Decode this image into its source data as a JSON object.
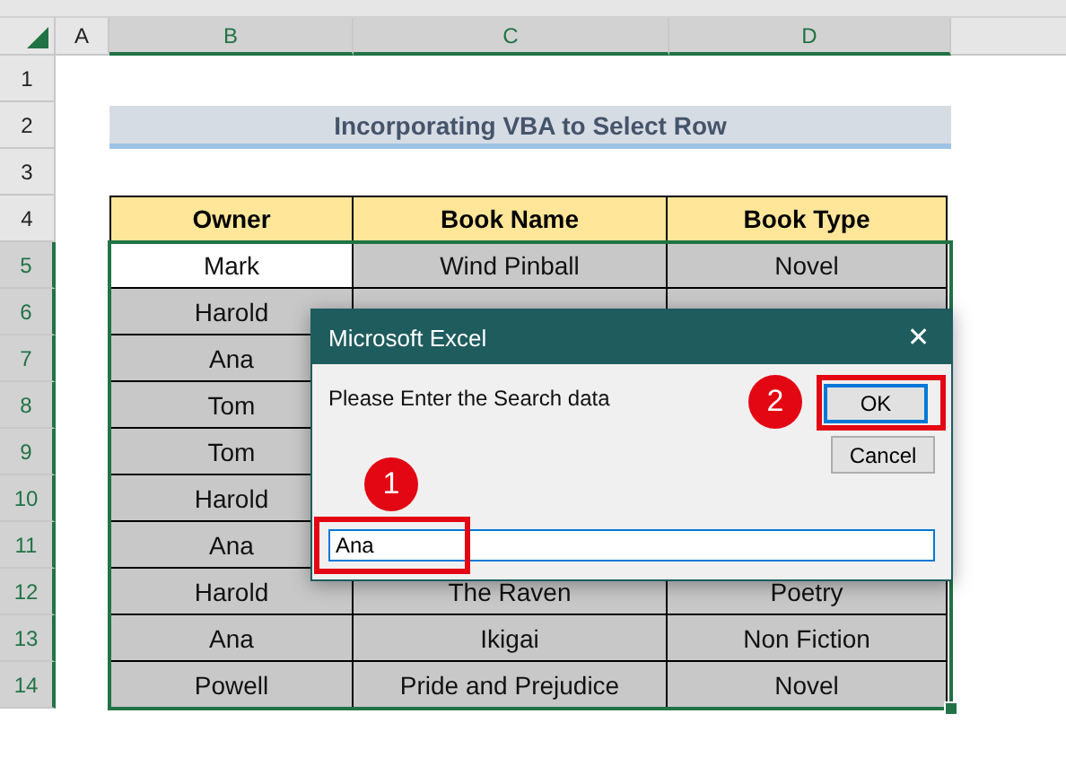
{
  "columns": [
    {
      "label": "A",
      "selected": false
    },
    {
      "label": "B",
      "selected": true
    },
    {
      "label": "C",
      "selected": true
    },
    {
      "label": "D",
      "selected": true
    }
  ],
  "row_numbers": [
    {
      "label": "1",
      "selected": false
    },
    {
      "label": "2",
      "selected": false
    },
    {
      "label": "3",
      "selected": false
    },
    {
      "label": "4",
      "selected": false
    },
    {
      "label": "5",
      "selected": true
    },
    {
      "label": "6",
      "selected": true
    },
    {
      "label": "7",
      "selected": true
    },
    {
      "label": "8",
      "selected": true
    },
    {
      "label": "9",
      "selected": true
    },
    {
      "label": "10",
      "selected": true
    },
    {
      "label": "11",
      "selected": true
    },
    {
      "label": "12",
      "selected": true
    },
    {
      "label": "13",
      "selected": true
    },
    {
      "label": "14",
      "selected": true
    }
  ],
  "title": "Incorporating VBA to Select Row",
  "table": {
    "columns": [
      "Owner",
      "Book Name",
      "Book Type"
    ],
    "rows": [
      {
        "cells": [
          "Mark",
          "Wind Pinball",
          "Novel"
        ],
        "active": true
      },
      {
        "cells": [
          "Harold"
        ],
        "active": false
      },
      {
        "cells": [
          "Ana"
        ],
        "active": false
      },
      {
        "cells": [
          "Tom"
        ],
        "active": false
      },
      {
        "cells": [
          "Tom"
        ],
        "active": false
      },
      {
        "cells": [
          "Harold"
        ],
        "active": false
      },
      {
        "cells": [
          "Ana"
        ],
        "active": false
      },
      {
        "cells": [
          "Harold",
          "The Raven",
          "Poetry"
        ],
        "active": false
      },
      {
        "cells": [
          "Ana",
          "Ikigai",
          "Non Fiction"
        ],
        "active": false
      },
      {
        "cells": [
          "Powell",
          "Pride and Prejudice",
          "Novel"
        ],
        "active": false
      }
    ]
  },
  "dialog": {
    "title": "Microsoft Excel",
    "close": "✕",
    "prompt": "Please Enter the Search data",
    "buttons": [
      "OK",
      "Cancel"
    ],
    "value": "Ana"
  },
  "callouts": [
    {
      "label": "1"
    },
    {
      "label": "2"
    }
  ]
}
